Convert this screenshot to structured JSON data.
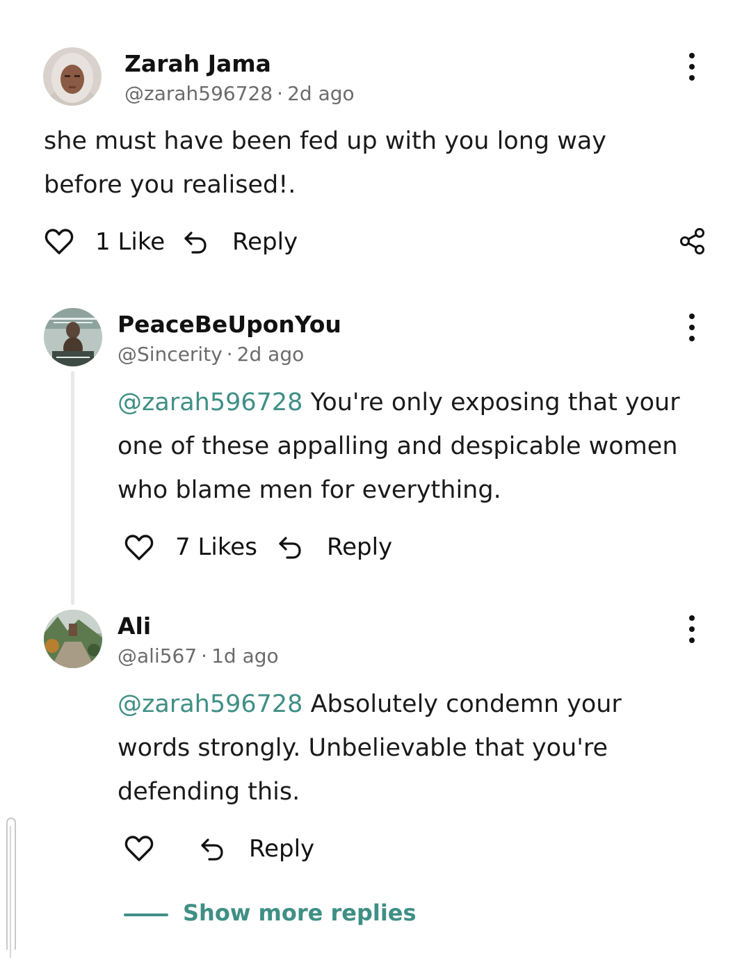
{
  "comments": [
    {
      "name": "Zarah Jama",
      "handle": "@zarah596728",
      "time": "2d ago",
      "mention": "",
      "text": "she must have been fed up with you long way before you realised!.",
      "likes_label": "1 Like",
      "reply_label": "Reply"
    },
    {
      "name": "PeaceBeUponYou",
      "handle": "@Sincerity",
      "time": "2d ago",
      "mention": "@zarah596728",
      "text": "You're only exposing that your one of these appalling and despicable women who blame men for everything.",
      "likes_label": "7 Likes",
      "reply_label": "Reply"
    },
    {
      "name": "Ali",
      "handle": "@ali567",
      "time": "1d ago",
      "mention": "@zarah596728",
      "text": "Absolutely condemn your words strongly. Unbelievable that you're defending this.",
      "likes_label": "",
      "reply_label": "Reply"
    }
  ],
  "separator": "·",
  "show_more_label": "Show more replies",
  "icons": {
    "like": "heart-outline-icon",
    "reply": "reply-arrow-icon",
    "share": "share-icon",
    "more": "more-vertical-icon"
  },
  "colors": {
    "accent": "#3f8f85",
    "text": "#111111",
    "muted": "#6b6b6b"
  }
}
